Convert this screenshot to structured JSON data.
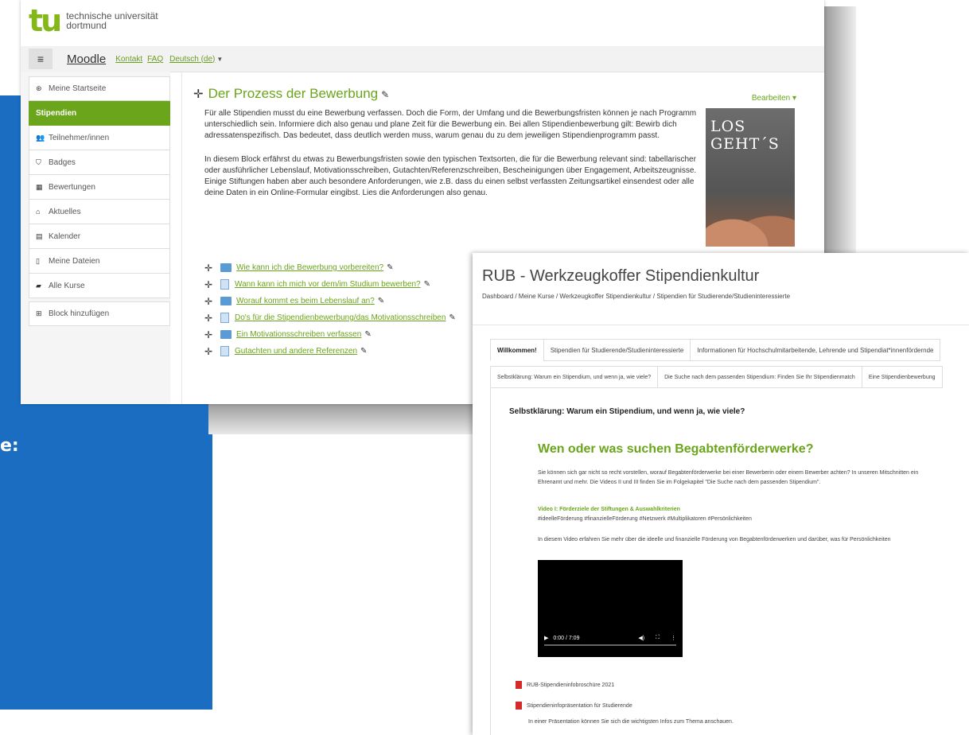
{
  "left_panel": {
    "text": "e:"
  },
  "moodle": {
    "logo": "tu",
    "university": [
      "technische universität",
      "dortmund"
    ],
    "nav": {
      "menu_icon": "≡",
      "site": "Moodle",
      "links": [
        "Kontakt",
        "FAQ"
      ],
      "language": "Deutsch (de)"
    },
    "sidebar": [
      {
        "label": "Meine Startseite",
        "icon": "tachometer-icon",
        "glyph": "⊛"
      },
      {
        "label": "Stipendien",
        "icon": "",
        "glyph": "",
        "active": true
      },
      {
        "label": "Teilnehmer/innen",
        "icon": "users-icon",
        "glyph": "👥"
      },
      {
        "label": "Badges",
        "icon": "shield-icon",
        "glyph": "⛉"
      },
      {
        "label": "Bewertungen",
        "icon": "table-icon",
        "glyph": "▦"
      },
      {
        "label": "Aktuelles",
        "icon": "home-icon",
        "glyph": "⌂"
      },
      {
        "label": "Kalender",
        "icon": "calendar-icon",
        "glyph": "▤"
      },
      {
        "label": "Meine Dateien",
        "icon": "file-icon",
        "glyph": "▯"
      },
      {
        "label": "Alle Kurse",
        "icon": "book-icon",
        "glyph": "▰"
      }
    ],
    "add_block": {
      "label": "Block hinzufügen",
      "icon": "plus-square-icon",
      "glyph": "⊞"
    },
    "section": {
      "title": "Der Prozess der Bewerbung",
      "edit_menu": "Bearbeiten ▾",
      "paragraph1": "Für alle Stipendien musst du eine Bewerbung verfassen. Doch die Form, der Umfang und die Bewerbungsfristen können je nach Programm unterschiedlich sein. Informiere dich also genau und plane Zeit für die Bewerbung ein. Bei allen Stipendienbewerbung gilt: Bewirb dich adressatenspezifisch. Das bedeutet, dass deutlich werden muss, warum genau du zu dem jeweiligen Stipendienprogramm passt.",
      "paragraph2": "In diesem Block erfährst du etwas zu Bewerbungsfristen sowie den typischen Textsorten, die für die Bewerbung relevant sind: tabellarischer oder ausführlicher Lebenslauf, Motivationsschreiben, Gutachten/Referenzschreiben, Bescheinigungen über Engagement, Arbeitszeugnisse. Einige Stiftungen haben aber auch besondere Anforderungen, wie z.B. dass du einen selbst verfassten Zeitungsartikel einsendest oder alle deine Daten in ein Online-Formular eingibst. Lies die Anforderungen also genau.",
      "image_text": "LOS GEHT´S"
    },
    "activities": [
      {
        "type": "folder",
        "label": "Wie kann ich die Bewerbung vorbereiten?"
      },
      {
        "type": "page",
        "label": "Wann kann ich mich vor dem/im Studium bewerben?"
      },
      {
        "type": "folder",
        "label": "Worauf kommt es beim Lebenslauf an?"
      },
      {
        "type": "page",
        "label": "Do's für die Stipendienbewerbung/das Motivationsschreiben"
      },
      {
        "type": "folder",
        "label": "Ein Motivationsschreiben verfassen"
      },
      {
        "type": "page",
        "label": "Gutachten und andere Referenzen"
      }
    ]
  },
  "rub": {
    "title": "RUB - Werkzeugkoffer Stipendienkultur",
    "breadcrumb": "Dashboard / Meine Kurse / Werkzeugkoffer Stipendienkultur / Stipendien für Studierende/Studieninteressierte",
    "tabs": [
      "Willkommen!",
      "Stipendien für Studierende/Studieninteressierte",
      "Informationen für Hochschulmitarbeitende, Lehrende und Stipendiat*innenfördernde"
    ],
    "subtabs": [
      "Selbstklärung: Warum ein Stipendium, und wenn ja, wie viele?",
      "Die Suche nach dem passenden Stipendium: Finden Sie Ihr Stipendienmatch",
      "Eine Stipendienbewerbung"
    ],
    "section_heading": "Selbstklärung: Warum ein Stipendium, und wenn ja, wie viele?",
    "heading": "Wen oder was suchen Begabtenförderwerke?",
    "intro_line1": "Sie können sich gar nicht so recht vorstellen, worauf Begabtenförderwerke bei einer Bewerberin oder einem Bewerber achten? In unseren Mitschnitten ein",
    "intro_line2": "Ehrenamt und mehr. Die Videos II und III finden Sie im Folgekapitel \"Die Suche nach dem passenden Stipendium\".",
    "video_title": "Video I: Förderziele der Stiftungen & Auswahlkriterien",
    "hashtags": "#ideelleFörderung #finanzielleFörderung #Netzwerk #Multiplikatoren #Persönlichkeiten",
    "video_desc": "In diesem Video erfahren Sie mehr über die ideelle und finanzielle Förderung von Begabtenförderwerken und darüber, was für Persönlichkeiten",
    "video_time": "0:00 / 7:09",
    "files": [
      "RUB-Stipendieninfobroschüre 2021",
      "Stipendieninfopräsentation für Studierende"
    ],
    "note": "In einer Präsentation können Sie sich die wichtigsten Infos zum Thema anschauen."
  }
}
